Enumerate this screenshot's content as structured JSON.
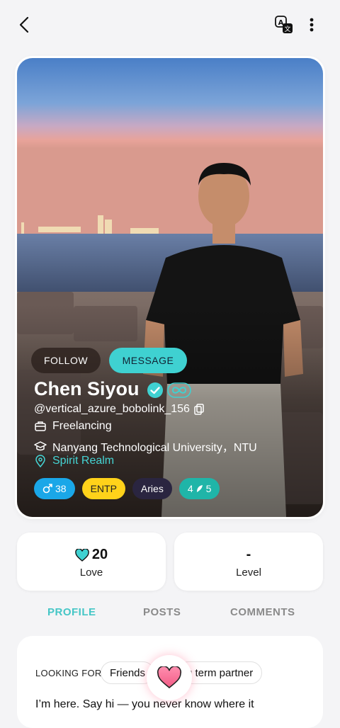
{
  "topbar": {
    "back_icon": "chevron-left-icon",
    "translate_icon": "translate-icon",
    "more_icon": "more-vertical-icon"
  },
  "profile": {
    "follow_label": "FOLLOW",
    "message_label": "MESSAGE",
    "name": "Chen Siyou",
    "handle": "@vertical_azure_bobolink_156",
    "job": "Freelancing",
    "education": "Nanyang Technological University，NTU",
    "location": "Spirit Realm",
    "tags": {
      "gender_age": "38",
      "mbti": "ENTP",
      "zodiac": "Aries",
      "wings": "5",
      "wings_prefix": "4"
    },
    "colors": {
      "accent": "#3fd1d1",
      "gender": "#1aa7e8",
      "mbti": "#ffd21a",
      "zodiac": "#2a2540",
      "wings": "#1fb5a8"
    }
  },
  "stats": {
    "love_value": "20",
    "love_label": "Love",
    "level_value": "-",
    "level_label": "Level"
  },
  "tabs": {
    "profile": "PROFILE",
    "posts": "POSTS",
    "comments": "COMMENTS"
  },
  "about": {
    "looking_for_label": "LOOKING FOR",
    "chip_1": "Friends",
    "chip_2": "g term partner",
    "bio": "I’m here. Say hi — you never know where it"
  }
}
